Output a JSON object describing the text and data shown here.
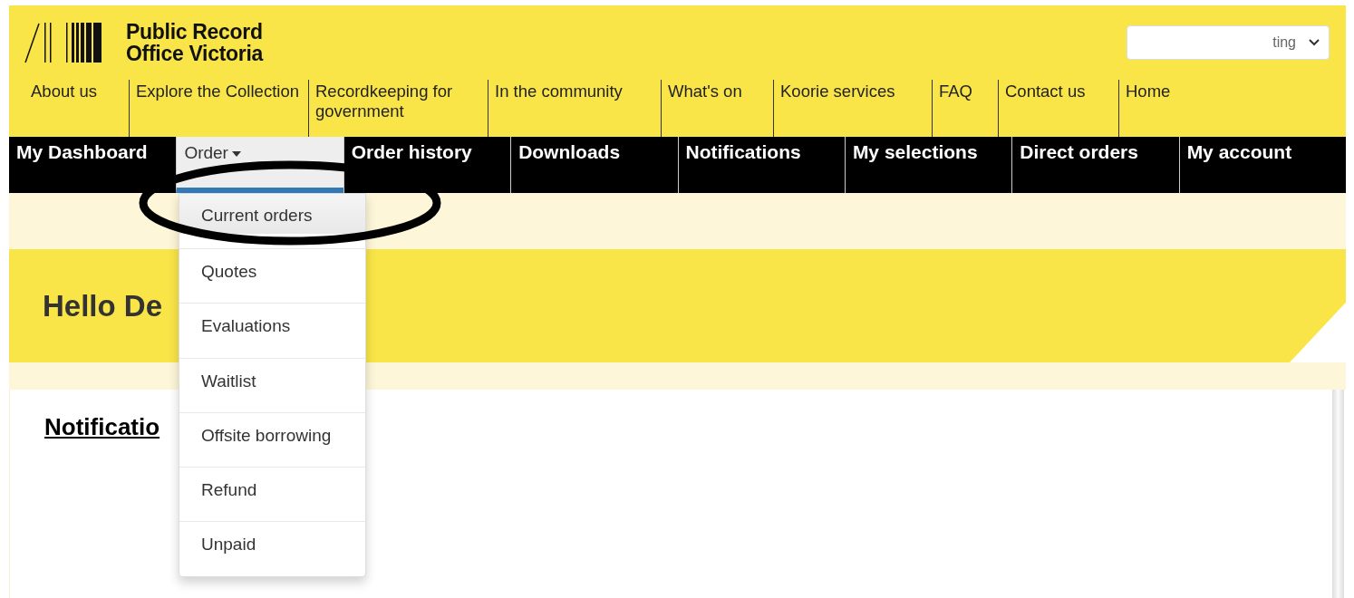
{
  "logo": {
    "line_1": "Public Record",
    "line_2": "Office Victoria"
  },
  "account_select": {
    "value": "ting"
  },
  "top_nav": [
    {
      "label": "About us"
    },
    {
      "label": "Explore the Collection"
    },
    {
      "label": "Recordkeeping for government"
    },
    {
      "label": "In the community"
    },
    {
      "label": "What's on"
    },
    {
      "label": "Koorie services"
    },
    {
      "label": "FAQ"
    },
    {
      "label": "Contact us"
    },
    {
      "label": "Home"
    }
  ],
  "user_nav": [
    {
      "label": "My Dashboard",
      "selected": false,
      "dropdown": false
    },
    {
      "label": "Order",
      "selected": true,
      "dropdown": true
    },
    {
      "label": "Order history",
      "selected": false,
      "dropdown": false
    },
    {
      "label": "Downloads",
      "selected": false,
      "dropdown": false
    },
    {
      "label": "Notifications",
      "selected": false,
      "dropdown": false
    },
    {
      "label": "My selections",
      "selected": false,
      "dropdown": false
    },
    {
      "label": "Direct orders",
      "selected": false,
      "dropdown": false
    },
    {
      "label": "My account",
      "selected": false,
      "dropdown": false
    }
  ],
  "order_menu": [
    {
      "label": "Current orders",
      "selected": true
    },
    {
      "label": "Quotes",
      "selected": false
    },
    {
      "label": "Evaluations",
      "selected": false
    },
    {
      "label": "Waitlist",
      "selected": false
    },
    {
      "label": "Offsite borrowing",
      "selected": false
    },
    {
      "label": "Refund",
      "selected": false
    },
    {
      "label": "Unpaid",
      "selected": false
    }
  ],
  "banner": {
    "greeting": "Hello De"
  },
  "content": {
    "heading": "Notificatio"
  }
}
